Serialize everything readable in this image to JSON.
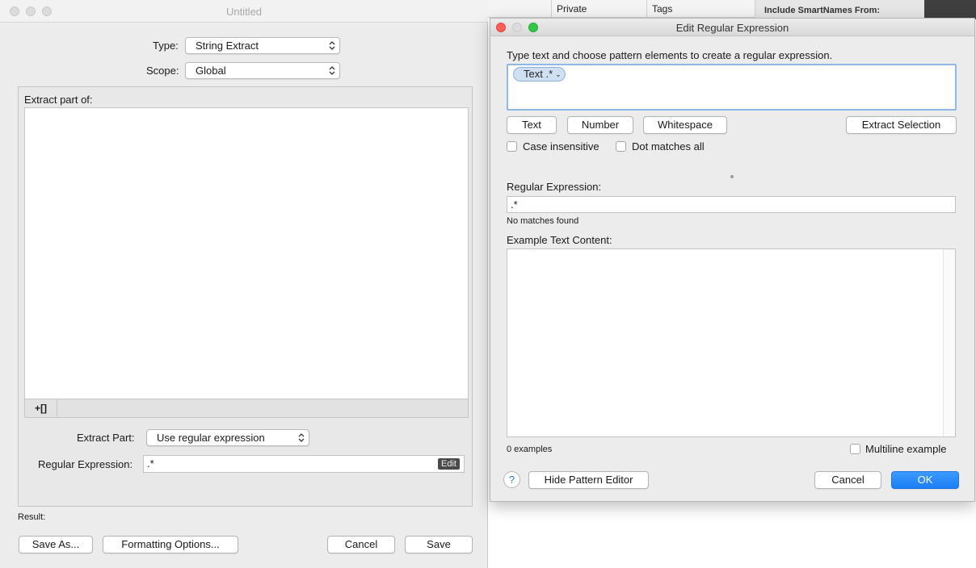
{
  "background": {
    "columns": [
      "Private",
      "Tags"
    ],
    "sidebar_title": "Include SmartNames From:"
  },
  "left_window": {
    "title": "Untitled",
    "type_label": "Type:",
    "type_value": "String Extract",
    "scope_label": "Scope:",
    "scope_value": "Global",
    "extract_part_of_label": "Extract part of:",
    "add_item_button": "+[]",
    "extract_part_label": "Extract Part:",
    "extract_part_value": "Use regular expression",
    "regex_label": "Regular Expression:",
    "regex_value": ".*",
    "edit_tag": "Edit",
    "result_label": "Result:",
    "buttons": {
      "save_as": "Save As...",
      "formatting": "Formatting Options...",
      "cancel": "Cancel",
      "save": "Save"
    }
  },
  "dialog": {
    "title": "Edit Regular Expression",
    "instructions": "Type text and choose pattern elements to create a regular expression.",
    "token_label": "Text .*",
    "pattern_buttons": {
      "text": "Text",
      "number": "Number",
      "whitespace": "Whitespace",
      "extract_selection": "Extract Selection"
    },
    "case_insensitive": "Case insensitive",
    "dot_matches_all": "Dot matches all",
    "regex_label": "Regular Expression:",
    "regex_value": ".*",
    "match_status": "No matches found",
    "example_label": "Example Text Content:",
    "examples_count": "0 examples",
    "multiline_example": "Multiline example",
    "help": "?",
    "hide_pattern_editor": "Hide Pattern Editor",
    "cancel": "Cancel",
    "ok": "OK"
  },
  "colors": {
    "accent": "#1a7ef5",
    "focus_ring": "#90b8e8",
    "token_bg": "#cfe0f3"
  }
}
